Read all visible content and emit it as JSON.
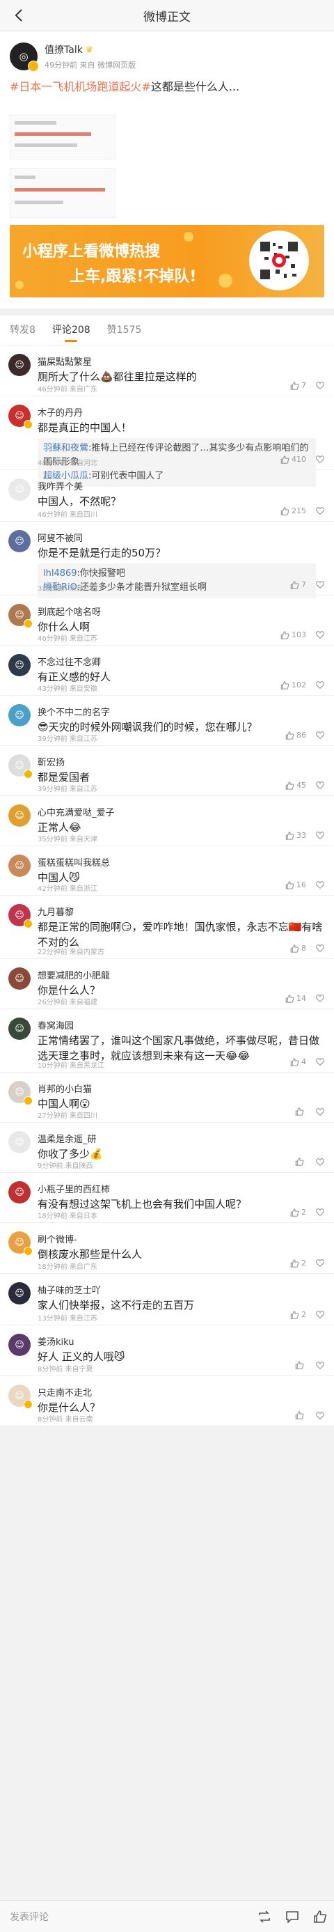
{
  "nav": {
    "title": "微博正文"
  },
  "post": {
    "author": "值撩Talk",
    "meta": "49分钟前  来自 微博网页版",
    "text_tag": "#日本一飞机机场跑道起火#",
    "text_rest": "这都是些什么人..."
  },
  "banner": {
    "line1": "小程序上看微博热搜",
    "line2": "上车,跟紧!不掉队!"
  },
  "tabs": {
    "repost": "转发8",
    "comments": "评论208",
    "likes": "赞1575"
  },
  "comments": [
    {
      "name": "猫屎點點繁星",
      "text": "厕所大了什么💩都往里拉是这样的",
      "meta": "46分钟前  来自广东",
      "likes": "7",
      "avatar_color": "#3b2a2a"
    },
    {
      "name": "木子的丹丹",
      "text": "都是真正的中国人！",
      "quotes": [
        {
          "name": "羽蘇和夜鶯",
          "text": ":推特上已经在传评论截图了…其实多少有点影响咱们的国际形象"
        },
        {
          "name": "超级小瓜瓜",
          "text": ":可别代表中国人了"
        }
      ],
      "meta": "48分钟前  来自河北",
      "likes": "410",
      "avatar_color": "#c9302c"
    },
    {
      "name": "我咋弄个美",
      "text": "中国人，不然呢？",
      "meta": "46分钟前  来自四川",
      "likes": "215",
      "avatar_color": "#e9e9e9"
    },
    {
      "name": "阿叟不被同",
      "text": "你是不是就是行走的50万？",
      "quotes": [
        {
          "name": "lhl4869",
          "text": ":你快报警吧"
        },
        {
          "name": "機動RiO",
          "text": ":还差多少条才能晋升狱室组长啊"
        }
      ],
      "meta": "32分钟前  来自广西",
      "likes": "7",
      "avatar_color": "#5b6e9e"
    },
    {
      "name": "到底起个啥名呀",
      "text": "你什么人啊",
      "meta": "46分钟前  来自江苏",
      "likes": "103",
      "avatar_color": "#b07850"
    },
    {
      "name": "不念过往不念卿",
      "text": "有正义感的好人",
      "meta": "43分钟前  来自安徽",
      "likes": "102",
      "avatar_color": "#2d3a4a"
    },
    {
      "name": "换个不中二的名字",
      "text": "😎天灾的时候外网嘲讽我们的时候，您在哪儿？",
      "meta": "39分钟前  来自江苏",
      "likes": "86",
      "avatar_color": "#4aa0c8"
    },
    {
      "name": "靳宏扬",
      "text": "都是爱国者",
      "meta": "39分钟前  来自江苏",
      "likes": "45",
      "avatar_color": "#ddd"
    },
    {
      "name": "心中充满爱哒_爱子",
      "text": "正常人😂",
      "meta": "35分钟前  来自天津",
      "likes": "33",
      "avatar_color": "#e0a030"
    },
    {
      "name": "蛋糕蛋糕叫我糕总",
      "text": "中国人😼",
      "meta": "42分钟前  来自浙江",
      "likes": "16",
      "avatar_color": "#c88a5a"
    },
    {
      "name": "九月暮黎",
      "text": "都是正常的同胞啊😏，爱咋咋地！国仇家恨，永志不忘🇨🇳有啥不对的么",
      "meta": "22分钟前  来自内蒙古",
      "likes": "8",
      "avatar_color": "#c0344c"
    },
    {
      "name": "想要减肥的小肥龍",
      "text": "你是什么人？",
      "meta": "26分钟前  来自福建",
      "likes": "14",
      "avatar_color": "#8a4a3a"
    },
    {
      "name": "春窝海园",
      "text": "正常情绪罢了，谁叫这个国家凡事做绝，坏事做尽呢，昔日做选天理之事时，就应该想到未来有这一天😂😂",
      "meta": "10分钟前  来自黑龙江",
      "likes": "4",
      "avatar_color": "#3a4a3a"
    },
    {
      "name": "肖邦的小白猫",
      "text": "中国人啊😮",
      "meta": "27分钟前  来自四川",
      "likes": "",
      "avatar_color": "#d8d0c8"
    },
    {
      "name": "温柔是余遥_研",
      "text": "你收了多少💰",
      "meta": "9分钟前  来自陕西",
      "likes": "",
      "avatar_color": "#e8e8e8"
    },
    {
      "name": "小瓶子里的西红柿",
      "text": "有没有想过这架飞机上也会有我们中国人呢？",
      "meta": "18分钟前  来自日本",
      "likes": "2",
      "avatar_color": "#c03030"
    },
    {
      "name": "刷个微博-",
      "text": "倒核废水那些是什么人",
      "meta": "18分钟前  来自广东",
      "likes": "2",
      "avatar_color": "#e8a040"
    },
    {
      "name": "柚子味的芝士吖",
      "text": "家人们快举报，这不行走的五百万",
      "meta": "13分钟前  来自江苏",
      "likes": "2",
      "avatar_color": "#2a2a3a"
    },
    {
      "name": "姜汤kiku",
      "text": "好人 正义的人哦😼",
      "meta": "8分钟前  来自宁夏",
      "likes": "",
      "avatar_color": "#5a3a6a"
    },
    {
      "name": "只走南不走北",
      "text": "你是什么人？",
      "meta": "8分钟前  来自云南",
      "likes": "",
      "avatar_color": "#e8d8c0"
    }
  ],
  "bottom": {
    "placeholder": "发表评论"
  }
}
